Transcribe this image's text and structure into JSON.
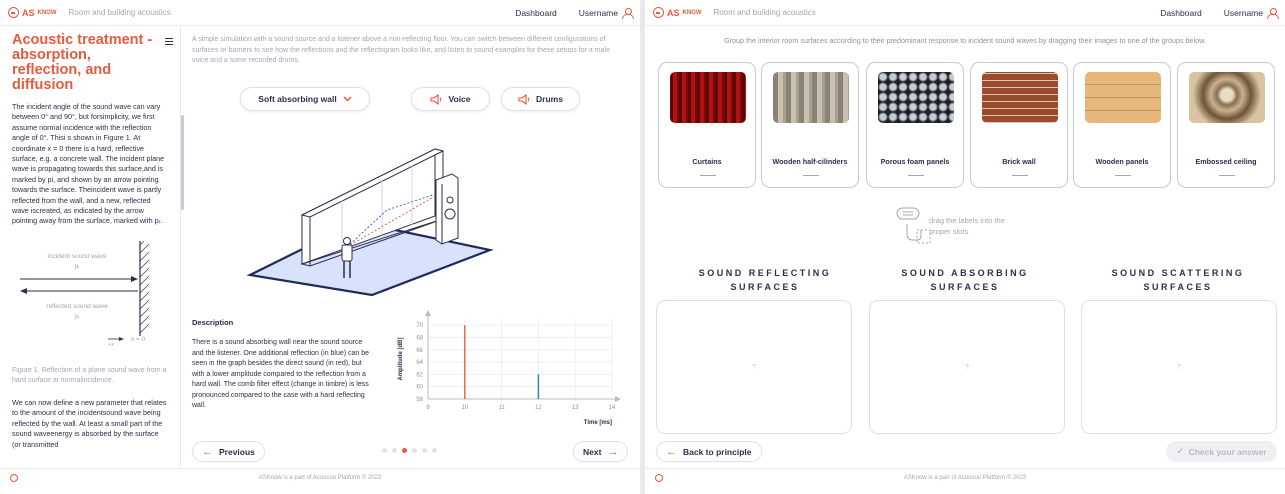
{
  "header": {
    "logo_text": "ASKNOW",
    "logo_main": "AS",
    "logo_sup": "KNOW",
    "app_title": "Room and building acoustics",
    "dashboard": "Dashboard",
    "username": "Username"
  },
  "theory": {
    "title": "Acoustic treatment - absorption, reflection, and diffusion",
    "para1": "The incident angle of the sound wave can vary between 0° and 90°, but forsimplicity, we first assume normal incidence with the reflection angle of 0°. Thisi s shown in Figure 1. At coordinate x = 0 there is a hard, reflective surface, e.g. a concrete wall. The incident plane wave is propagating towards this surface,and is marked by pi, and shown by an arrow pointing towards the surface. Theincident wave is partly reflected from the wall, and a new, reflected wave iscreated, as indicated by the arrow pointing away from the surface, marked with pᵣ.",
    "figure": {
      "incident_label": "incident sound wave",
      "incident_symbol": "pᵢ",
      "reflected_label": "reflected sound wave",
      "reflected_symbol": "pᵣ",
      "axis_label": "+x",
      "origin_label": "x = 0",
      "caption": "Figure 1. Reflection of a plane sound wave from a hard surface at normalincidence."
    },
    "para2": "We can now define a new parameter that relates to the amount of the incidentsound wave being reflected by the wall. At least a small part of the sound waveenergy is absorbed by the surface (or transmitted"
  },
  "simulation": {
    "intro": "A simple simulation with a sound source and a listener above a non-reflecting floor. You can switch between different configurations of surfaces or barriers to see how the reflections and the reflectogram looks like, and listen to sound examples for these setups for a male voice and a some recorded drums.",
    "select_value": "Soft absorbing wall",
    "voice_label": "Voice",
    "drums_label": "Drums",
    "description_title": "Description",
    "description": "There is a sound absorbing wall near the sound source and the listener. One additional reflection (in blue) can be seen in the graph besides the direct sound (in red), but with a lower amplitude compared to the reflection from a hard wall. The comb filter effect (change in timbre) is less pronounced compared to the case with a hard reflecting wall.",
    "previous": "Previous",
    "next": "Next",
    "page_count": 6,
    "active_page": 3
  },
  "chart_data": {
    "type": "bar",
    "ylabel": "Amplitude [dB]",
    "xlabel": "Time [ms]",
    "xlim": [
      9,
      14
    ],
    "ylim": [
      58,
      71
    ],
    "xticks": [
      9,
      10,
      11,
      12,
      13,
      14
    ],
    "yticks": [
      58,
      60,
      62,
      64,
      66,
      68,
      70
    ],
    "series": [
      {
        "x": 10,
        "y": 70,
        "color": "#e8674a"
      },
      {
        "x": 12,
        "y": 62,
        "color": "#2a8ca3"
      }
    ]
  },
  "exercise": {
    "instruction": "Group the interior room surfaces according to their predominant response to incident sound waves by dragging their images to one of the groups below.",
    "cards": [
      {
        "label": "Curtains",
        "icon": "curtains-image"
      },
      {
        "label": "Wooden half-cilinders",
        "icon": "wooden-half-cylinders-image"
      },
      {
        "label": "Porous foam panels",
        "icon": "foam-panels-image"
      },
      {
        "label": "Brick wall",
        "icon": "brick-wall-image"
      },
      {
        "label": "Wooden panels",
        "icon": "wooden-panels-image"
      },
      {
        "label": "Embossed ceiling",
        "icon": "embossed-ceiling-image"
      }
    ],
    "hint": "drag the labels into the proper slots",
    "groups": [
      {
        "title": "SOUND REFLECTING SURFACES",
        "placeholder": "?"
      },
      {
        "title": "SOUND ABSORBING SURFACES",
        "placeholder": "?"
      },
      {
        "title": "SOUND SCATTERING SURFACES",
        "placeholder": "?"
      }
    ],
    "back": "Back to principle",
    "check": "Check your answer"
  },
  "footer": "ASKnow is a part of Acoucou Platform © 2023",
  "colors": {
    "accent": "#e85a3c",
    "text": "#2c2e4a",
    "muted": "#a3a6b6",
    "floor": "#d8e2fb",
    "blue": "#2a8ca3"
  }
}
